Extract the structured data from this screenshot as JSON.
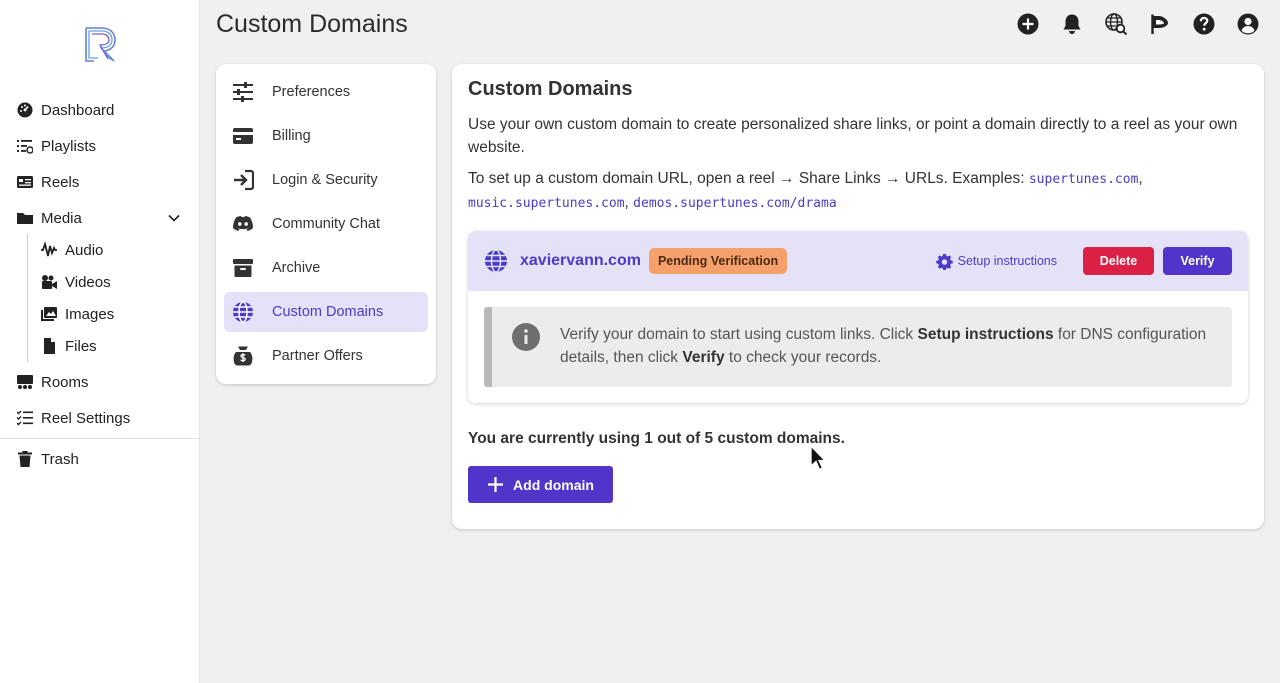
{
  "sidebar": {
    "items": [
      {
        "label": "Dashboard",
        "icon": "gauge-icon"
      },
      {
        "label": "Playlists",
        "icon": "playlist-icon"
      },
      {
        "label": "Reels",
        "icon": "reel-icon"
      },
      {
        "label": "Media",
        "icon": "folder-icon"
      },
      {
        "label": "Audio",
        "icon": "waveform-icon"
      },
      {
        "label": "Videos",
        "icon": "video-icon"
      },
      {
        "label": "Images",
        "icon": "images-icon"
      },
      {
        "label": "Files",
        "icon": "file-icon"
      },
      {
        "label": "Rooms",
        "icon": "rooms-icon"
      },
      {
        "label": "Reel Settings",
        "icon": "list-check-icon"
      },
      {
        "label": "Trash",
        "icon": "trash-icon"
      }
    ]
  },
  "header": {
    "title": "Custom Domains",
    "icons": [
      "add-circle-icon",
      "bell-icon",
      "globe-search-icon",
      "flag-icon",
      "help-icon",
      "account-icon"
    ]
  },
  "settings_menu": {
    "items": [
      {
        "label": "Preferences",
        "icon": "sliders-icon"
      },
      {
        "label": "Billing",
        "icon": "credit-card-icon"
      },
      {
        "label": "Login & Security",
        "icon": "login-icon"
      },
      {
        "label": "Community Chat",
        "icon": "discord-icon"
      },
      {
        "label": "Archive",
        "icon": "archive-icon"
      },
      {
        "label": "Custom Domains",
        "icon": "globe-icon",
        "active": true
      },
      {
        "label": "Partner Offers",
        "icon": "money-bag-icon"
      }
    ]
  },
  "main": {
    "title": "Custom Domains",
    "description": "Use your own custom domain to create personalized share links, or point a domain directly to a reel as your own website.",
    "setup_prefix": "To set up a custom domain URL, open a reel → Share Links → URLs. Examples: ",
    "examples": [
      "supertunes.com",
      "music.supertunes.com",
      "demos.supertunes.com/drama"
    ],
    "domain": {
      "name": "xaviervann.com",
      "status": "Pending Verification",
      "setup_label": "Setup instructions",
      "delete_label": "Delete",
      "verify_label": "Verify",
      "notice": {
        "part1": "Verify your domain to start using custom links. Click ",
        "bold1": "Setup instructions",
        "part2": " for DNS configuration details, then click ",
        "bold2": "Verify",
        "part3": " to check your records."
      }
    },
    "usage": "You are currently using 1 out of 5 custom domains.",
    "add_label": "Add domain"
  },
  "colors": {
    "accent": "#5134c9",
    "accent_text": "#4a3cc7",
    "badge": "#f6a06c",
    "danger": "#dc1f45",
    "domain_header": "#e5e2f8"
  }
}
